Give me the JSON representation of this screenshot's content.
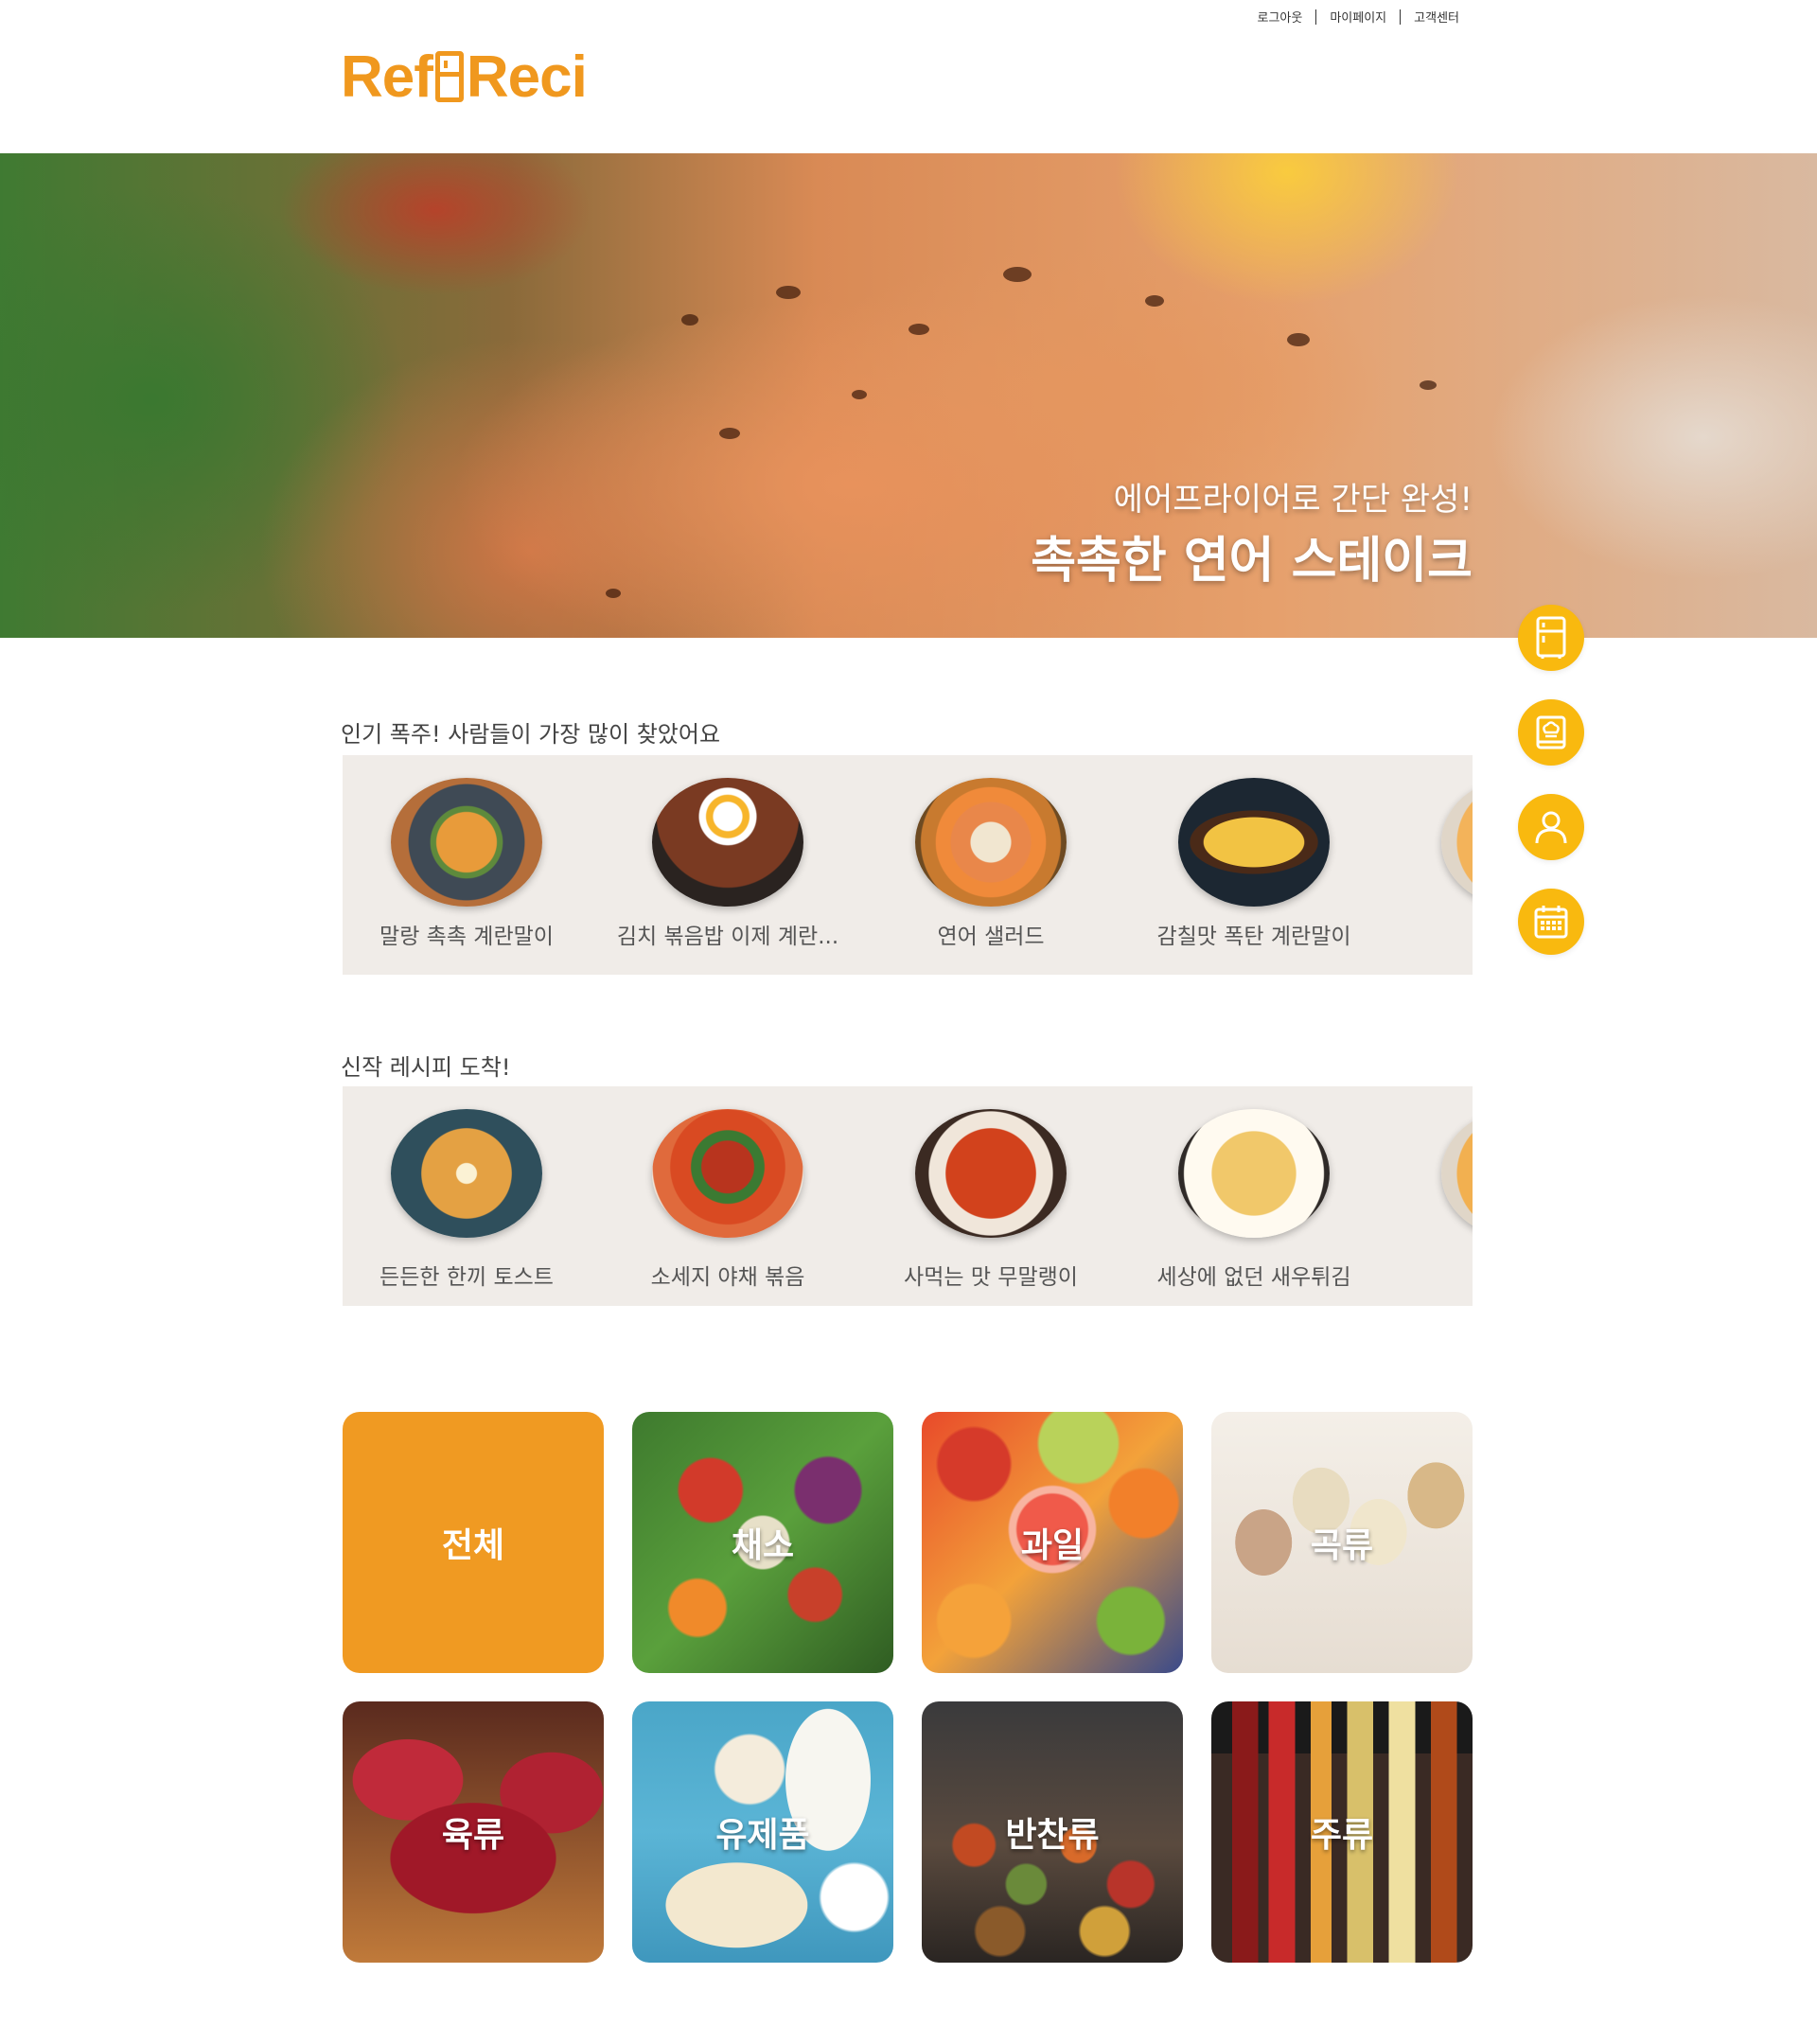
{
  "header": {
    "util_links": [
      "로그아웃",
      "마이페이지",
      "고객센터"
    ],
    "logo_left": "Ref",
    "logo_right": "Reci"
  },
  "hero": {
    "subtitle": "에어프라이어로 간단 완성!",
    "title": "촉촉한 연어 스테이크"
  },
  "quick_menu": [
    "fridge-icon",
    "recipe-book-icon",
    "user-icon",
    "calendar-icon"
  ],
  "popular": {
    "heading": "인기 폭주! 사람들이 가장 많이 찾았어요",
    "items": [
      "말랑 촉촉 계란말이",
      "김치 볶음밥 이제 계란...",
      "연어 샐러드",
      "감칠맛 폭탄 계란말이"
    ]
  },
  "new_recipes": {
    "heading": "신작 레시피 도착!",
    "items": [
      "든든한 한끼 토스트",
      "소세지 야채 볶음",
      "사먹는 맛 무말랭이",
      "세상에 없던 새우튀김"
    ]
  },
  "categories": [
    "전체",
    "채소",
    "과일",
    "곡류",
    "육류",
    "유제품",
    "반찬류",
    "주류"
  ],
  "colors": {
    "brand": "#f0981e",
    "quick_menu": "#f9b90f",
    "strip_bg": "#f0ece8"
  }
}
